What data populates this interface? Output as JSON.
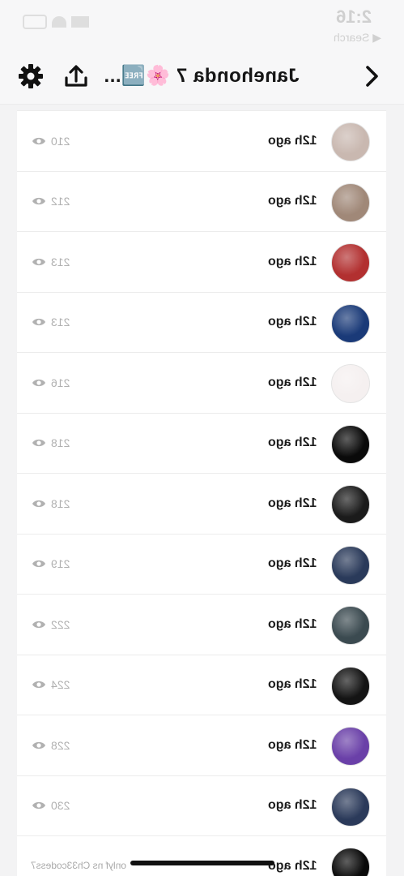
{
  "status_bar": {
    "time": "2:16",
    "back_label": "◀ Search"
  },
  "header": {
    "title": "Janehonda 7 🌸🆓...",
    "icons": [
      "gear-icon",
      "upload-icon",
      "chevron-right-icon"
    ]
  },
  "list": {
    "items": [
      {
        "views": "210",
        "time_ago": "12h ago",
        "thumb_color": "#c9b8b0"
      },
      {
        "views": "212",
        "time_ago": "12h ago",
        "thumb_color": "#a08878"
      },
      {
        "views": "213",
        "time_ago": "12h ago",
        "thumb_color": "#b23030"
      },
      {
        "views": "213",
        "time_ago": "12h ago",
        "thumb_color": "#1a3a78"
      },
      {
        "views": "216",
        "time_ago": "12h ago",
        "thumb_color": "#f5f0f0"
      },
      {
        "views": "218",
        "time_ago": "12h ago",
        "thumb_color": "#0a0a0a"
      },
      {
        "views": "218",
        "time_ago": "12h ago",
        "thumb_color": "#1b1b1b"
      },
      {
        "views": "219",
        "time_ago": "12h ago",
        "thumb_color": "#2a3a5a"
      },
      {
        "views": "222",
        "time_ago": "12h ago",
        "thumb_color": "#3b4a50"
      },
      {
        "views": "224",
        "time_ago": "12h ago",
        "thumb_color": "#141414"
      },
      {
        "views": "228",
        "time_ago": "12h ago",
        "thumb_color": "#6a40a8"
      },
      {
        "views": "230",
        "time_ago": "12h ago",
        "thumb_color": "#2b3a5a"
      },
      {
        "views": "",
        "time_ago": "12h ago",
        "thumb_color": "#0a0a0a"
      }
    ]
  },
  "watermark": "onlyf ns Ch33codess7"
}
